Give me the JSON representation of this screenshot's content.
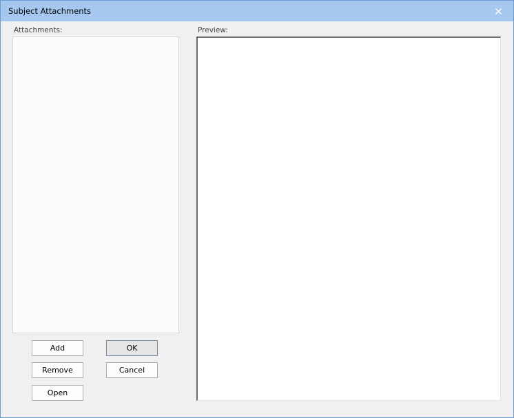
{
  "window": {
    "title": "Subject Attachments"
  },
  "attachments": {
    "label": "Attachments:",
    "items": []
  },
  "preview": {
    "label": "Preview:"
  },
  "buttons": {
    "add": "Add",
    "ok": "OK",
    "remove": "Remove",
    "cancel": "Cancel",
    "open": "Open"
  },
  "icons": {
    "close": "close-icon"
  },
  "colors": {
    "titlebar": "#a7c8ee",
    "window_border": "#6c9bd1",
    "dialog_bg": "#f0f0f0"
  }
}
